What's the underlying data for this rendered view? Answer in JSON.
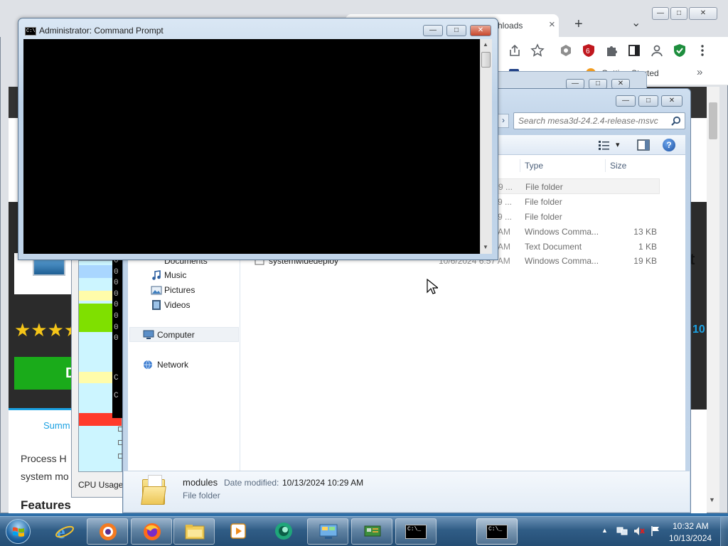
{
  "chrome": {
    "tab_title": "hloads",
    "tab_close": "×",
    "new_tab": "+",
    "tab_list": "⌄",
    "bookmark_getting_started": "Getting Started",
    "bookmark_more": "»",
    "win_min": "—",
    "win_max": "□",
    "win_close": "✕",
    "icons": [
      "share-icon",
      "star-icon",
      "extension-shield-icon",
      "ublock-icon",
      "puzzle-icon",
      "sidepanel-icon",
      "profile-icon",
      "security-shield-icon",
      "menu-icon"
    ],
    "page": {
      "stars": "★★★★",
      "download_label": "D",
      "summary_link": "Summ",
      "para_line1": "Process H",
      "para_line2": "system mo",
      "features_heading": "Features",
      "right_number": "10",
      "hamburger": "☰",
      "right_dark_glyph": "t"
    }
  },
  "process_hacker": {
    "cpu_usage_label": "CPU Usage:",
    "console_lines": [
      "0",
      "0",
      "0",
      "0",
      "0",
      "0",
      "0",
      "0",
      "0",
      "0",
      "C",
      "C"
    ]
  },
  "explorer": {
    "search_placeholder": "Search mesa3d-24.2.4-release-msvc",
    "nav_arrow": "›",
    "views_dropdown": "▾",
    "help_label": "?",
    "columns": {
      "type": "Type",
      "size": "Size"
    },
    "rows": [
      {
        "date": "9 ...",
        "type": "File folder",
        "size": ""
      },
      {
        "date": "9 ...",
        "type": "File folder",
        "size": ""
      },
      {
        "date": "9 ...",
        "type": "File folder",
        "size": ""
      },
      {
        "date": "AM",
        "type": "Windows Comma...",
        "size": "13 KB"
      },
      {
        "date": "AM",
        "type": "Text Document",
        "size": "1 KB"
      }
    ],
    "last_row": {
      "name": "systemwidedeploy",
      "date": "10/6/2024 6:57 AM",
      "type": "Windows Comma...",
      "size": "19 KB"
    },
    "nav": [
      {
        "label": "Documents",
        "icon": "documents-icon"
      },
      {
        "label": "Music",
        "icon": "music-icon"
      },
      {
        "label": "Pictures",
        "icon": "pictures-icon"
      },
      {
        "label": "Videos",
        "icon": "videos-icon"
      },
      {
        "label": "Computer",
        "icon": "computer-icon"
      },
      {
        "label": "Network",
        "icon": "network-icon"
      }
    ],
    "details": {
      "name": "modules",
      "date_label": "Date modified:",
      "date_value": "10/13/2024 10:29 AM",
      "type": "File folder"
    }
  },
  "cmd": {
    "title": "Administrator: Command Prompt",
    "icon_text": "C:\\",
    "scroll_up": "▲",
    "scroll_down": "▼"
  },
  "taskbar": {
    "apps": [
      {
        "name": "internet-explorer-icon"
      },
      {
        "name": "avast-browser-icon"
      },
      {
        "name": "firefox-icon"
      },
      {
        "name": "file-explorer-icon"
      },
      {
        "name": "media-player-icon"
      },
      {
        "name": "teams-like-icon"
      },
      {
        "name": "control-panel-icon"
      },
      {
        "name": "device-manager-icon"
      },
      {
        "name": "cmd-icon"
      },
      {
        "name": "cmd-icon-2"
      }
    ],
    "cmd_glyph": "C:\\_",
    "tray_arrow": "▲",
    "time": "10:32 AM",
    "date": "10/13/2024"
  },
  "colors": {
    "taskbar": "#2d5a82",
    "console": "#000000",
    "link_blue": "#1ba1e2",
    "download_green": "#1aab1a",
    "star_gold": "#f5c518"
  }
}
